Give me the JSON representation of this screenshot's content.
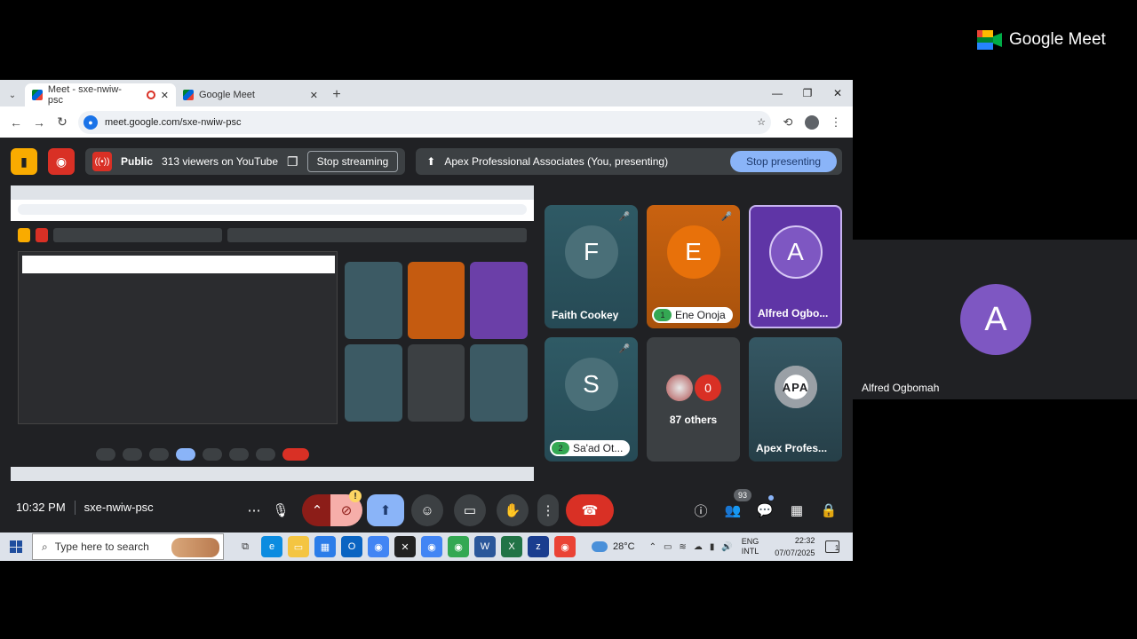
{
  "browser": {
    "tabs": [
      {
        "label": "Meet - sxe-nwiw-psc",
        "active": true
      },
      {
        "label": "Google Meet",
        "active": false
      }
    ],
    "url": "meet.google.com/sxe-nwiw-psc"
  },
  "meet": {
    "stream": {
      "visibility": "Public",
      "viewers": "313 viewers on YouTube",
      "stop_label": "Stop streaming"
    },
    "presenting": {
      "label": "Apex Professional Associates (You, presenting)",
      "stop_label": "Stop presenting"
    },
    "tiles": [
      {
        "initial": "F",
        "name": "Faith Cookey",
        "style": "teal",
        "muted": true
      },
      {
        "initial": "E",
        "name": "Ene Onoja",
        "style": "orange",
        "muted": true,
        "badge": "1"
      },
      {
        "initial": "A",
        "name": "Alfred Ogbo...",
        "style": "purple",
        "muted": false
      },
      {
        "initial": "S",
        "name": "Sa'ad Ot...",
        "style": "teal",
        "muted": true,
        "badge": "2"
      },
      {
        "others_initial": "0",
        "name": "87 others",
        "style": "grey"
      },
      {
        "logo_text": "APA",
        "name": "Apex Profes...",
        "style": "apex"
      }
    ],
    "time": "10:32 PM",
    "meeting_code": "sxe-nwiw-psc",
    "participants_count": "93",
    "colors": {
      "red": "#d93025",
      "blue": "#8ab4f8",
      "panel": "#202124"
    }
  },
  "taskbar": {
    "search_placeholder": "Type here to search",
    "weather": "28°C",
    "lang_line1": "ENG",
    "lang_line2": "INTL",
    "clock_time": "22:32",
    "clock_date": "07/07/2025",
    "notif_count": "1"
  },
  "right": {
    "brand": "Google Meet",
    "user_initial": "A",
    "user_name": "Alfred Ogbomah"
  }
}
